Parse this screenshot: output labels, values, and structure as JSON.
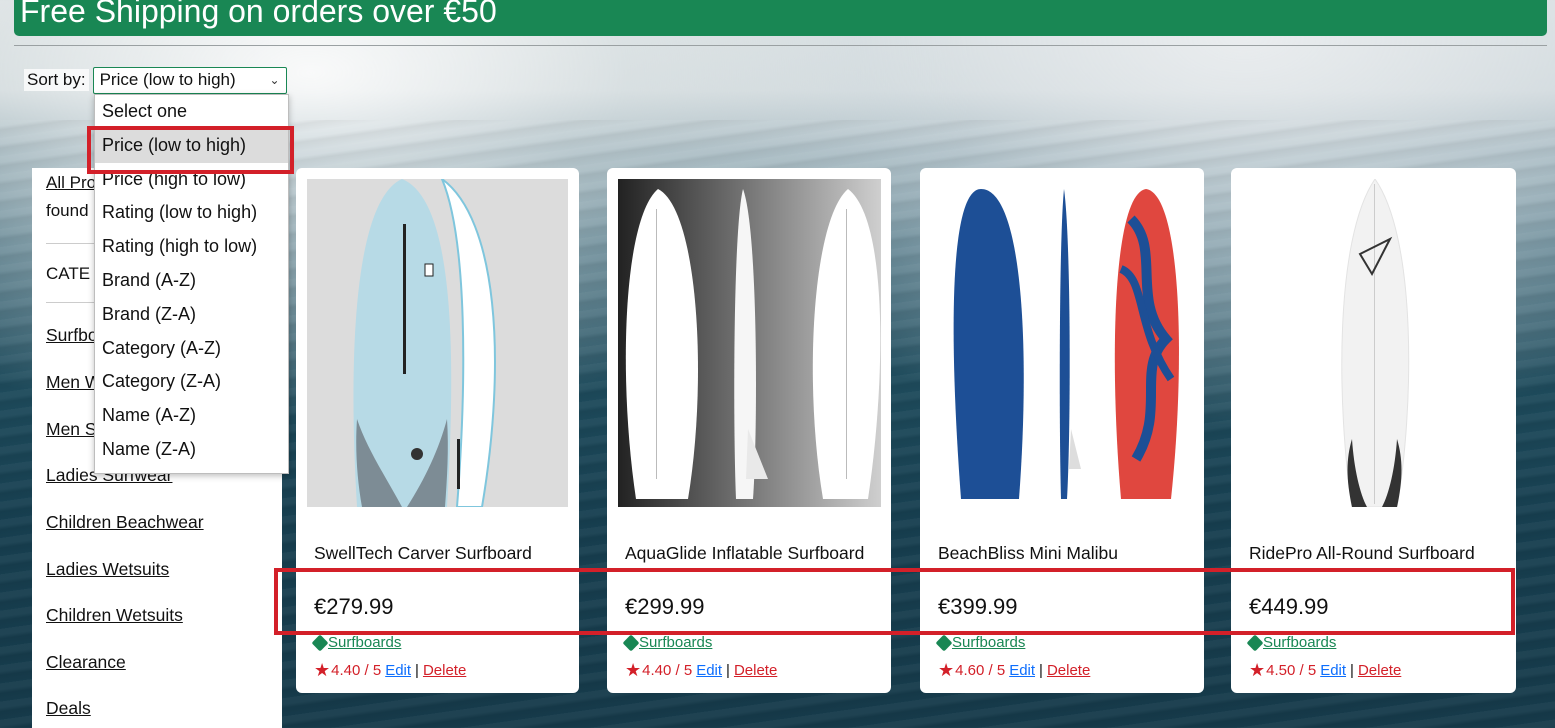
{
  "banner": {
    "text": "Free Shipping on orders over €50"
  },
  "sort": {
    "label": "Sort by:",
    "selected": "Price (low to high)",
    "options": [
      "Select one",
      "Price (low to high)",
      "Price (high to low)",
      "Rating (low to high)",
      "Rating (high to low)",
      "Brand (A-Z)",
      "Brand (Z-A)",
      "Category (A-Z)",
      "Category (Z-A)",
      "Name (A-Z)",
      "Name (Z-A)"
    ]
  },
  "sidebar": {
    "all_products": "All Pro",
    "found": "found",
    "categories_heading": "CATE",
    "links": [
      "Surfbo",
      "Men W",
      "Men S",
      "Ladies Surfwear",
      "Children Beachwear",
      "Ladies Wetsuits",
      "Children Wetsuits",
      "Clearance",
      "Deals"
    ]
  },
  "products": [
    {
      "name": "SwellTech Carver Surfboard",
      "price": "€279.99",
      "category": "Surfboards",
      "rating": "4.40 / 5",
      "edit": "Edit",
      "sep": "|",
      "delete": "Delete"
    },
    {
      "name": "AquaGlide Inflatable Surfboard",
      "price": "€299.99",
      "category": "Surfboards",
      "rating": "4.40 / 5",
      "edit": "Edit",
      "sep": "|",
      "delete": "Delete"
    },
    {
      "name": "BeachBliss Mini Malibu",
      "price": "€399.99",
      "category": "Surfboards",
      "rating": "4.60 / 5",
      "edit": "Edit",
      "sep": "|",
      "delete": "Delete"
    },
    {
      "name": "RidePro All-Round Surfboard",
      "price": "€449.99",
      "category": "Surfboards",
      "rating": "4.50 / 5",
      "edit": "Edit",
      "sep": "|",
      "delete": "Delete"
    }
  ],
  "colors": {
    "brand_green": "#198754",
    "highlight_red": "#d32029",
    "link_blue": "#0d6efd"
  }
}
